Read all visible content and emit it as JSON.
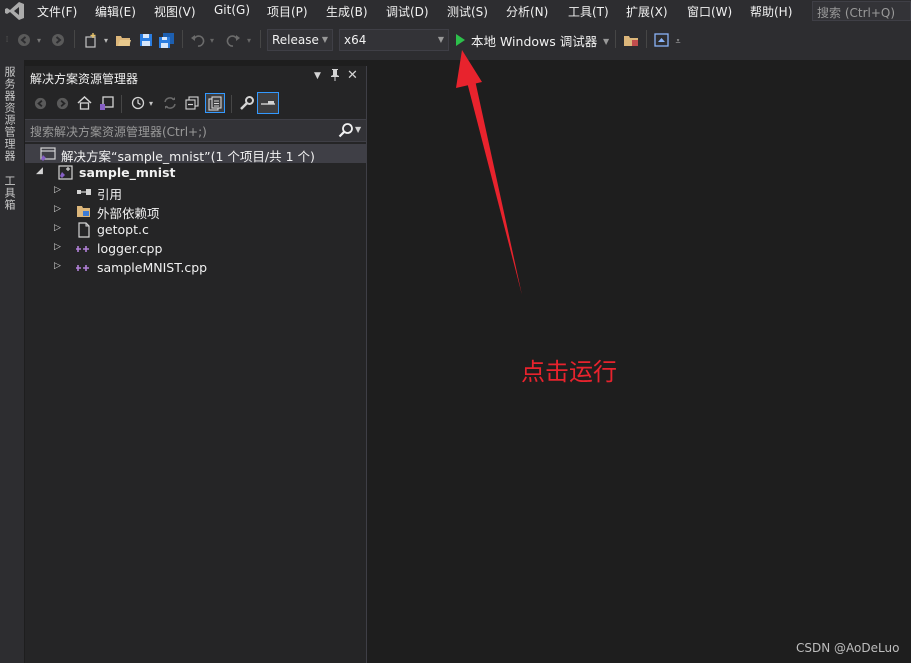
{
  "menu": {
    "items": [
      "文件(F)",
      "编辑(E)",
      "视图(V)",
      "Git(G)",
      "项目(P)",
      "生成(B)",
      "调试(D)",
      "测试(S)",
      "分析(N)",
      "工具(T)",
      "扩展(X)",
      "窗口(W)",
      "帮助(H)"
    ],
    "search_placeholder": "搜索 (Ctrl+Q)"
  },
  "toolbar": {
    "configuration": "Release",
    "platform": "x64",
    "run_label": "本地 Windows 调试器"
  },
  "left_strip": {
    "tabs": [
      "服务器资源管理器",
      "工具箱"
    ]
  },
  "solution_explorer": {
    "title": "解决方案资源管理器",
    "search_placeholder": "搜索解决方案资源管理器(Ctrl+;)",
    "solution_label": "解决方案“sample_mnist”(1 个项目/共 1 个)",
    "project_label": "sample_mnist",
    "items": [
      {
        "label": "引用",
        "icon": "references-icon"
      },
      {
        "label": "外部依赖项",
        "icon": "external-deps-icon"
      },
      {
        "label": "getopt.c",
        "icon": "c-file-icon"
      },
      {
        "label": "logger.cpp",
        "icon": "cpp-file-icon"
      },
      {
        "label": "sampleMNIST.cpp",
        "icon": "cpp-file-icon"
      }
    ]
  },
  "annotation": {
    "text": "点击运行",
    "color": "#e8232d"
  },
  "watermark": "CSDN @AoDeLuo",
  "colors": {
    "accent": "#3399ff",
    "run_green": "#2dc04b",
    "vs_purple": "#865fc5"
  }
}
